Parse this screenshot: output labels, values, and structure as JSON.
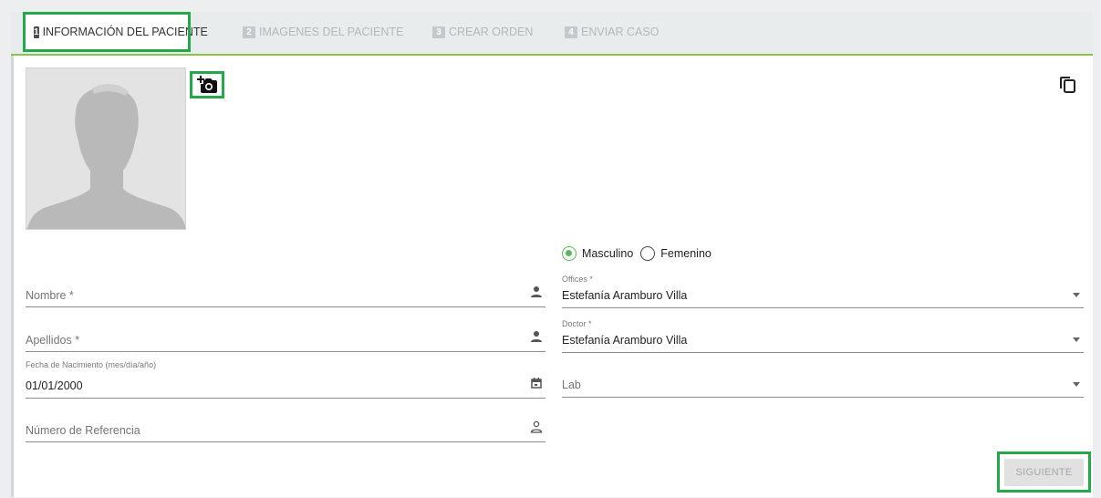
{
  "tabs": [
    {
      "num": "1",
      "label": "INFORMACIÓN DEL PACIENTE"
    },
    {
      "num": "2",
      "label": "IMAGENES DEL PACIENTE"
    },
    {
      "num": "3",
      "label": "CREAR ORDEN"
    },
    {
      "num": "4",
      "label": "ENVIAR CASO"
    }
  ],
  "icons": {
    "avatar": "person-silhouette-icon",
    "camera": "add-photo-camera-icon",
    "copy": "copy-icon",
    "person": "person-icon",
    "calendar": "calendar-icon",
    "person_outline": "person-outline-icon",
    "dropdown": "chevron-down-icon"
  },
  "form": {
    "nombre": {
      "placeholder": "Nombre *",
      "value": ""
    },
    "apellidos": {
      "placeholder": "Apellidos *",
      "value": ""
    },
    "fecha": {
      "label": "Fecha de Nacimiento (mes/día/año)",
      "value": "01/01/2000"
    },
    "referencia": {
      "placeholder": "Número de Referencia",
      "value": ""
    },
    "gender": {
      "options": [
        "Masculino",
        "Femenino"
      ],
      "selected": "Masculino"
    },
    "offices": {
      "label": "Offices *",
      "value": "Estefanía Aramburo Villa"
    },
    "doctor": {
      "label": "Doctor *",
      "value": "Estefanía Aramburo Villa"
    },
    "lab": {
      "placeholder": "Lab",
      "value": ""
    }
  },
  "buttons": {
    "next": "SIGUIENTE"
  },
  "colors": {
    "accent": "#8bc34a",
    "highlight": "#25a84a",
    "radio_selected": "#5cb85c"
  }
}
